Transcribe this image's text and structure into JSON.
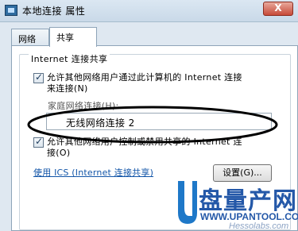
{
  "window": {
    "title": "本地连接 属性",
    "close_glyph": "X"
  },
  "tabs": [
    {
      "label": "网络",
      "active": false
    },
    {
      "label": "共享",
      "active": true
    }
  ],
  "sharing": {
    "group_title": "Internet 连接共享",
    "allow_connect": {
      "line1": "允许其他网络用户通过此计算机的 Internet 连接",
      "line2": "来连接(N)",
      "checked": true
    },
    "home_network_label": "家庭网络连接(H):",
    "home_network_value": "无线网络连接 2",
    "allow_control": {
      "line1": "允许其他网络用户控制或禁用共享的 Internet 连",
      "line2": "接(O)",
      "checked": true
    },
    "ics_link": "使用 ICS (Internet 连接共享)",
    "settings_button": "设置(G)..."
  },
  "watermark": {
    "brand": "盘量产网",
    "url": "WWW.UPANTOOL.COM",
    "small": "Hessolabs.com"
  },
  "colors": {
    "window_bg": "#dfe8f1",
    "link": "#1255a8",
    "watermark_blue": "#2458a8",
    "highlight_ellipse": "#000000"
  }
}
